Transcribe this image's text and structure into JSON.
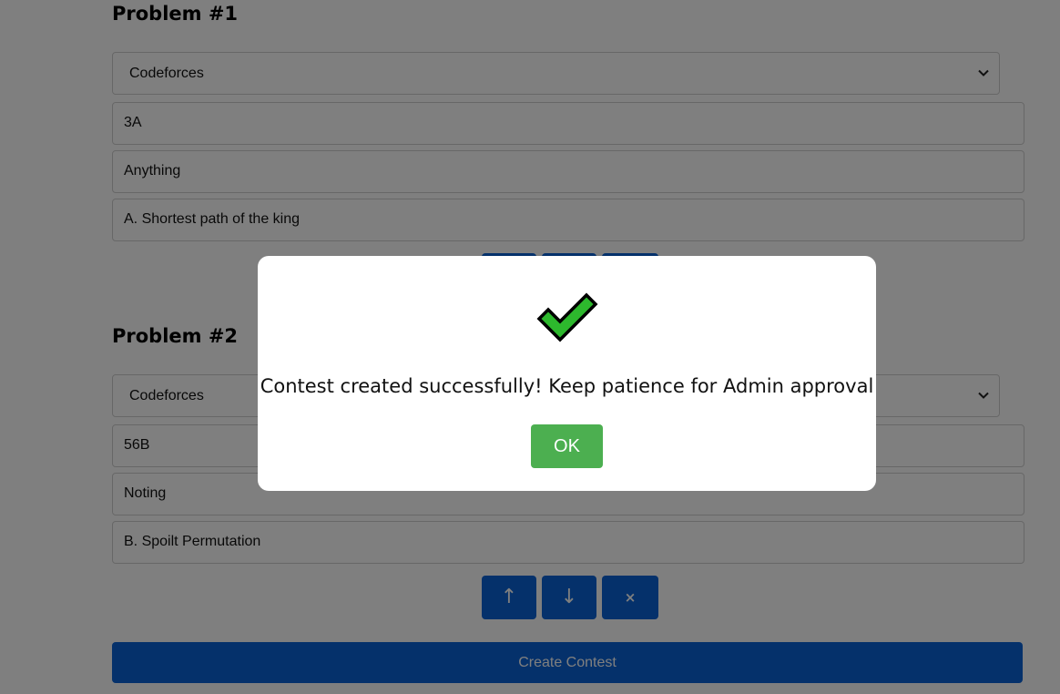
{
  "problems": [
    {
      "title": "Problem #1",
      "platform": "Codeforces",
      "problem_id": "3A",
      "alias": "Anything",
      "problem_name": "A. Shortest path of the king"
    },
    {
      "title": "Problem #2",
      "platform": "Codeforces",
      "problem_id": "56B",
      "alias": "Noting",
      "problem_name": "B. Spoilt Permutation"
    }
  ],
  "controls": {
    "move_up": "↑",
    "move_down": "↓",
    "remove": "×"
  },
  "create_button": "Create Contest",
  "modal": {
    "icon": "success-check-icon",
    "message": "Contest created successfully! Keep patience for Admin approval",
    "ok_label": "OK"
  },
  "colors": {
    "primary_button": "#0b63d6",
    "ok_button": "#4caf50",
    "check_green": "#2db82d",
    "overlay": "rgba(0,0,0,0.5)"
  }
}
